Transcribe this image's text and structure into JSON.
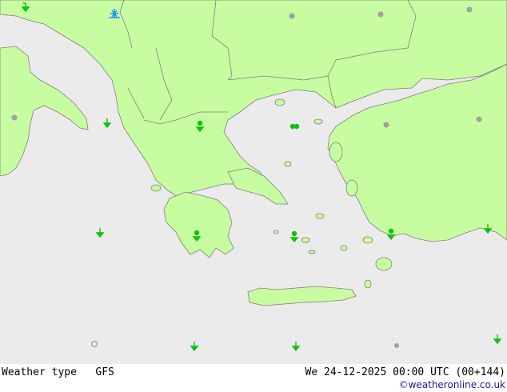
{
  "footer": {
    "product_label": "Weather type",
    "model": "GFS",
    "datetime": "We 24-12-2025 00:00 UTC (00+144)",
    "credit": "©weatheronline.co.uk"
  },
  "colors": {
    "sea": "#ebebeb",
    "land": "#c8fca0",
    "border": "#7f7f7f",
    "symbol_drizzle": "#10c010",
    "symbol_snow": "#1090ff",
    "symbol_cloud": "#a0a0a0"
  },
  "legend_symbols": [
    "drizzle-symbol",
    "snow-symbol",
    "overcast-dot-symbol",
    "open-circle-symbol"
  ]
}
